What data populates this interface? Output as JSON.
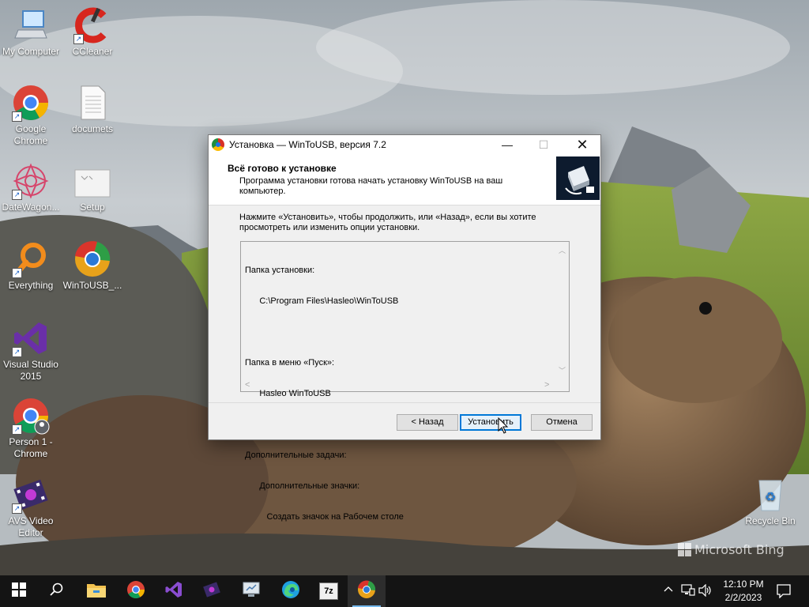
{
  "desktop": {
    "icons": [
      {
        "label": "My Computer"
      },
      {
        "label": "CCleaner"
      },
      {
        "label": "Google Chrome"
      },
      {
        "label": "documets"
      },
      {
        "label": "DateWagon..."
      },
      {
        "label": "Setup"
      },
      {
        "label": "Everything"
      },
      {
        "label": "WinToUSB_..."
      },
      {
        "label": "Visual Studio 2015"
      },
      {
        "label": "Person 1 - Chrome"
      },
      {
        "label": "AVS Video Editor"
      },
      {
        "label": "Recycle Bin"
      }
    ],
    "watermark": "Microsoft Bing"
  },
  "dialog": {
    "title": "Установка — WinToUSB, версия 7.2",
    "controls": {
      "minimize": "—",
      "maximize": "☐",
      "close": "✕"
    },
    "header_title": "Всё готово к установке",
    "header_subtitle": "Программа установки готова начать установку WinToUSB на ваш компьютер.",
    "instruction": "Нажмите «Установить», чтобы продолжить, или «Назад», если вы хотите просмотреть или изменить опции установки.",
    "memo_lines": [
      "Папка установки:",
      "      C:\\Program Files\\Hasleo\\WinToUSB",
      "",
      "Папка в меню «Пуск»:",
      "      Hasleo WinToUSB",
      "",
      "Дополнительные задачи:",
      "      Дополнительные значки:",
      "         Создать значок на Рабочем столе"
    ],
    "buttons": {
      "back": "< Назад",
      "install": "Установить",
      "cancel": "Отмена"
    }
  },
  "taskbar": {
    "pinned": [
      "start-icon",
      "search-icon",
      "file-explorer-icon",
      "chrome-icon",
      "visual-studio-icon",
      "avs-video-icon",
      "remote-desktop-icon",
      "edge-icon",
      "7zip-icon",
      "wintousb-icon"
    ],
    "sevenzip_label": "7z",
    "clock_time": "12:10 PM",
    "clock_date": "2/2/2023"
  },
  "colors": {
    "accent": "#0078d7",
    "taskbar": "#141414",
    "dialog_bg": "#f0f0f0"
  }
}
